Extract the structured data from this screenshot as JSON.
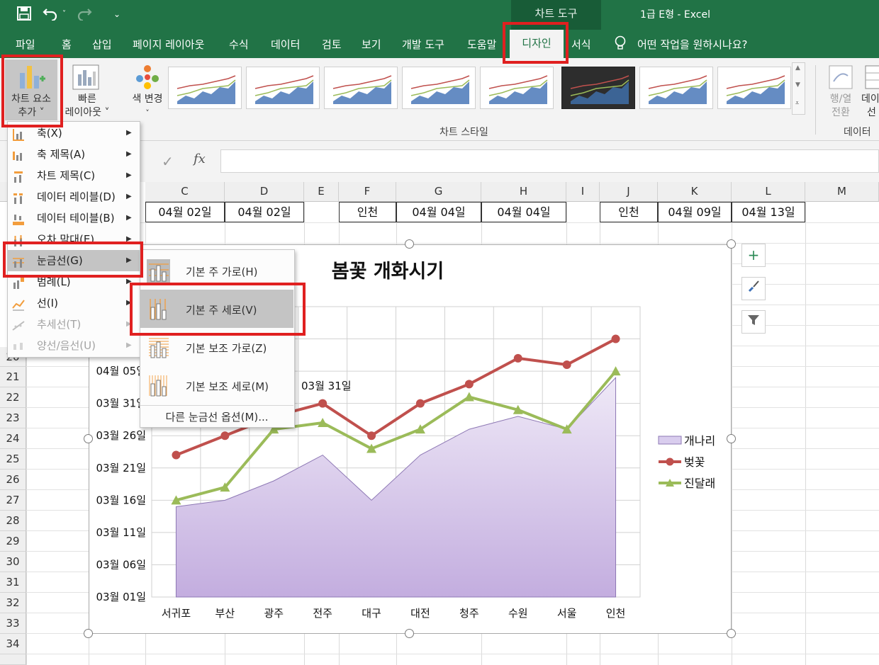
{
  "window": {
    "context_tab_group": "차트 도구",
    "title": "1급 E형  -  Excel"
  },
  "tabs": [
    {
      "label": "파일"
    },
    {
      "label": "홈"
    },
    {
      "label": "삽입"
    },
    {
      "label": "페이지 레이아웃"
    },
    {
      "label": "수식"
    },
    {
      "label": "데이터"
    },
    {
      "label": "검토"
    },
    {
      "label": "보기"
    },
    {
      "label": "개발 도구"
    },
    {
      "label": "도움말"
    },
    {
      "label": "디자인",
      "active": true
    },
    {
      "label": "서식"
    }
  ],
  "tell_me": "어떤 작업을 원하시나요?",
  "ribbon": {
    "add_chart_element": [
      "차트 요소",
      "추가 ˅"
    ],
    "quick_layout": [
      "빠른",
      "레이아웃 ˅"
    ],
    "change_colors": [
      "색 변경",
      "˅"
    ],
    "chart_styles_group": "차트 스타일",
    "switch_row_col": [
      "행/열",
      "전환"
    ],
    "select_data": [
      "데이",
      "선"
    ],
    "data_group": "데이터"
  },
  "formula_bar": {
    "fx": "fx"
  },
  "columns": [
    "C",
    "D",
    "E",
    "F",
    "G",
    "H",
    "I",
    "J",
    "K",
    "L",
    "M"
  ],
  "rows": [
    "20",
    "21",
    "22",
    "23",
    "24",
    "25",
    "26",
    "27",
    "28",
    "29",
    "30",
    "31",
    "32",
    "33",
    "34"
  ],
  "cells": {
    "c": "04월 02일",
    "d": "04월 02일",
    "f": "인천",
    "g": "04월 04일",
    "h": "04월 04일",
    "j": "인천",
    "k": "04월 09일",
    "l": "04월 13일"
  },
  "menu": {
    "items": [
      {
        "label": "축(X)"
      },
      {
        "label": "축 제목(A)"
      },
      {
        "label": "차트 제목(C)"
      },
      {
        "label": "데이터 레이블(D)"
      },
      {
        "label": "데이터 테이블(B)"
      },
      {
        "label": "오차 막대(E)"
      },
      {
        "label": "눈금선(G)",
        "highlighted": true
      },
      {
        "label": "범례(L)"
      },
      {
        "label": "선(I)"
      },
      {
        "label": "추세선(T)",
        "disabled": true
      },
      {
        "label": "양선/음선(U)",
        "disabled": true
      }
    ]
  },
  "submenu": {
    "items": [
      {
        "label": "기본 주 가로(H)"
      },
      {
        "label": "기본 주 세로(V)",
        "highlighted": true
      },
      {
        "label": "기본 보조 가로(Z)"
      },
      {
        "label": "기본 보조 세로(M)"
      }
    ],
    "more": "다른 눈금선 옵션(M)..."
  },
  "colors": {
    "excel_green": "#217346",
    "cherry": "#c0504d",
    "azalea": "#9bbb59",
    "forsythia_fill": "#ccc0e6",
    "highlight": "#e02020"
  },
  "chart_data": {
    "type": "line",
    "title": "봄꽃 개화시기",
    "categories": [
      "서귀포",
      "부산",
      "광주",
      "전주",
      "대구",
      "대전",
      "청주",
      "수원",
      "서울",
      "인천"
    ],
    "series": [
      {
        "name": "개나리",
        "kind": "area",
        "values": [
          "03-15",
          "03-16",
          "03-19",
          "03-23",
          "03-16",
          "03-23",
          "03-27",
          "03-29",
          "03-27",
          "04-04"
        ]
      },
      {
        "name": "벚꽃",
        "kind": "line",
        "marker": "circle",
        "values": [
          "03-23",
          "03-26",
          "03-29",
          "03-31",
          "03-26",
          "03-31",
          "04-03",
          "04-07",
          "04-06",
          "04-10"
        ]
      },
      {
        "name": "진달래",
        "kind": "line",
        "marker": "triangle",
        "values": [
          "03-16",
          "03-18",
          "03-27",
          "03-28",
          "03-24",
          "03-27",
          "04-01",
          "03-30",
          "03-27",
          "04-05"
        ]
      }
    ],
    "y_tick_labels": [
      "03월 01일",
      "03월 06일",
      "03월 11일",
      "03월 16일",
      "03월 21일",
      "03월 26일",
      "03월 31일",
      "04월 05일"
    ],
    "ylim": [
      "03-01",
      "04-15"
    ],
    "data_label": "03월 31일",
    "legend": "right",
    "grid": true
  }
}
